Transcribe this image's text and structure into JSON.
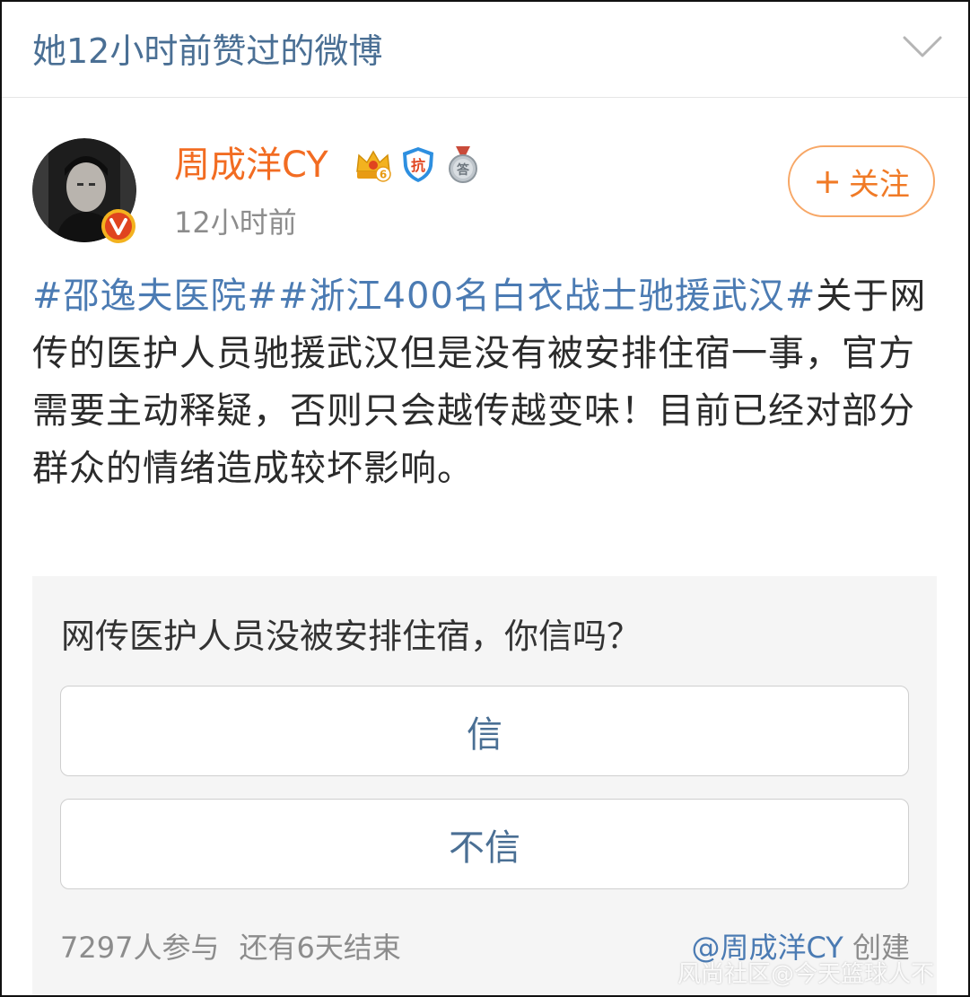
{
  "section": {
    "title": "她12小时前赞过的微博"
  },
  "post": {
    "username": "周成洋CY",
    "timestamp": "12小时前",
    "follow_label": "关注",
    "follow_icon": "+",
    "hashtags": [
      "#邵逸夫医院#",
      "#浙江400名白衣战士驰援武汉#"
    ],
    "text": "关于网传的医护人员驰援武汉但是没有被安排住宿一事，官方需要主动释疑，否则只会越传越变味！目前已经对部分群众的情绪造成较坏影响。"
  },
  "badges": {
    "crown_level": "6",
    "kang": "抗",
    "medal": "答"
  },
  "poll": {
    "question": "网传医护人员没被安排住宿，你信吗？",
    "options": [
      "信",
      "不信"
    ],
    "participants": "7297人参与",
    "remaining": "还有6天结束",
    "creator_handle": "@周成洋CY",
    "creator_suffix": "创建"
  },
  "watermark": "风尚社区@今天篮球人不",
  "colors": {
    "link_blue": "#4b7bb3",
    "header_blue": "#4a6f94",
    "orange": "#f26c22",
    "verified_red": "#e0441f",
    "gold": "#f3b21f"
  }
}
